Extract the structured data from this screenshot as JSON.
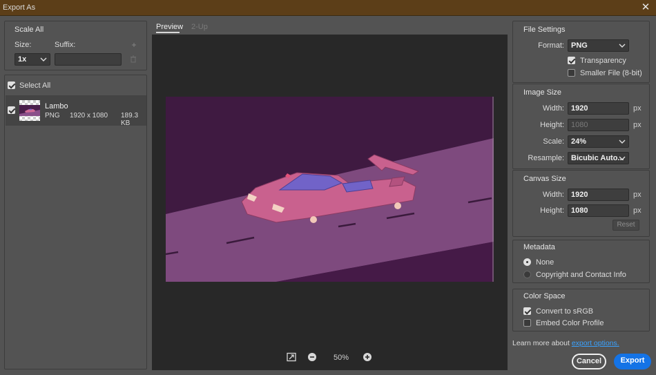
{
  "window": {
    "title": "Export As"
  },
  "scale_all": {
    "title": "Scale All",
    "size_label": "Size:",
    "suffix_label": "Suffix:",
    "size_value": "1x",
    "suffix_value": ""
  },
  "assets": {
    "select_all_label": "Select All",
    "select_all_checked": true,
    "items": [
      {
        "name": "Lambo",
        "format": "PNG",
        "dimensions": "1920 x 1080",
        "file_size": "189.3 KB",
        "checked": true
      }
    ]
  },
  "preview": {
    "tabs": [
      {
        "label": "Preview",
        "active": true
      },
      {
        "label": "2-Up",
        "active": false
      }
    ],
    "zoom": "50%"
  },
  "file_settings": {
    "title": "File Settings",
    "format_label": "Format:",
    "format_value": "PNG",
    "transparency_label": "Transparency",
    "transparency_checked": true,
    "smaller_file_label": "Smaller File (8-bit)",
    "smaller_file_checked": false
  },
  "image_size": {
    "title": "Image Size",
    "width_label": "Width:",
    "width_value": "1920",
    "height_label": "Height:",
    "height_value": "1080",
    "scale_label": "Scale:",
    "scale_value": "24%",
    "resample_label": "Resample:",
    "resample_value": "Bicubic Auto...",
    "unit": "px"
  },
  "canvas_size": {
    "title": "Canvas Size",
    "width_label": "Width:",
    "width_value": "1920",
    "height_label": "Height:",
    "height_value": "1080",
    "unit": "px",
    "reset_label": "Reset"
  },
  "metadata": {
    "title": "Metadata",
    "options": [
      {
        "label": "None",
        "selected": true
      },
      {
        "label": "Copyright and Contact Info",
        "selected": false
      }
    ]
  },
  "color_space": {
    "title": "Color Space",
    "convert_label": "Convert to sRGB",
    "convert_checked": true,
    "embed_label": "Embed Color Profile",
    "embed_checked": false
  },
  "footer": {
    "learn_text": "Learn more about",
    "learn_link": "export options.",
    "cancel_label": "Cancel",
    "export_label": "Export"
  },
  "colors": {
    "accent": "#1473e6",
    "link": "#3aa2ff",
    "titlebar": "#5c3e18",
    "preview_bg": "#3e1a40",
    "road": "#7e4a7e"
  }
}
